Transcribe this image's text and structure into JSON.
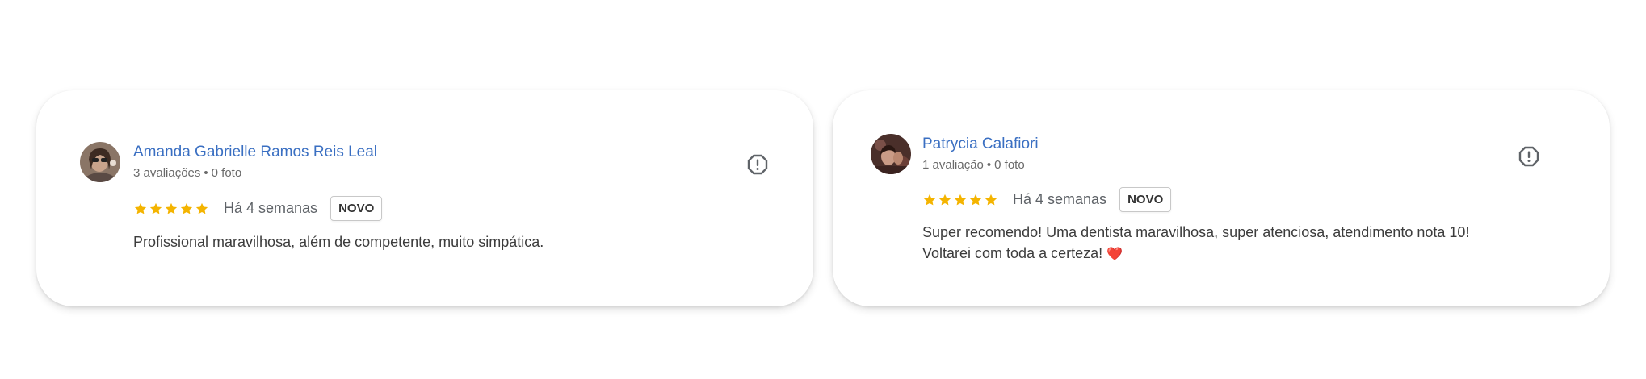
{
  "reviews": [
    {
      "author": "Amanda Gabrielle Ramos Reis Leal",
      "reviews_count": "3 avaliações",
      "separator": "•",
      "photos_count": "0 foto",
      "rating": 5,
      "time_ago": "Há 4 semanas",
      "badge": "NOVO",
      "text_lines": [
        "Profissional maravilhosa, além de competente, muito simpática."
      ],
      "avatar_icon": "user-photo-avatar"
    },
    {
      "author": "Patrycia Calafiori",
      "reviews_count": "1 avaliação",
      "separator": "•",
      "photos_count": "0 foto",
      "rating": 5,
      "time_ago": "Há 4 semanas",
      "badge": "NOVO",
      "text_lines": [
        "Super recomendo! Uma dentista maravilhosa, super atenciosa, atendimento nota 10!",
        "Voltarei com toda a certeza!"
      ],
      "emoji": "❤️",
      "avatar_icon": "user-photo-avatar"
    }
  ],
  "colors": {
    "author_link": "#3a6fc2",
    "star": "#f4b400",
    "text": "#3c3c3c",
    "meta": "#6a6a6a"
  },
  "icons": {
    "star": "star-icon",
    "report": "report-flag-icon"
  }
}
